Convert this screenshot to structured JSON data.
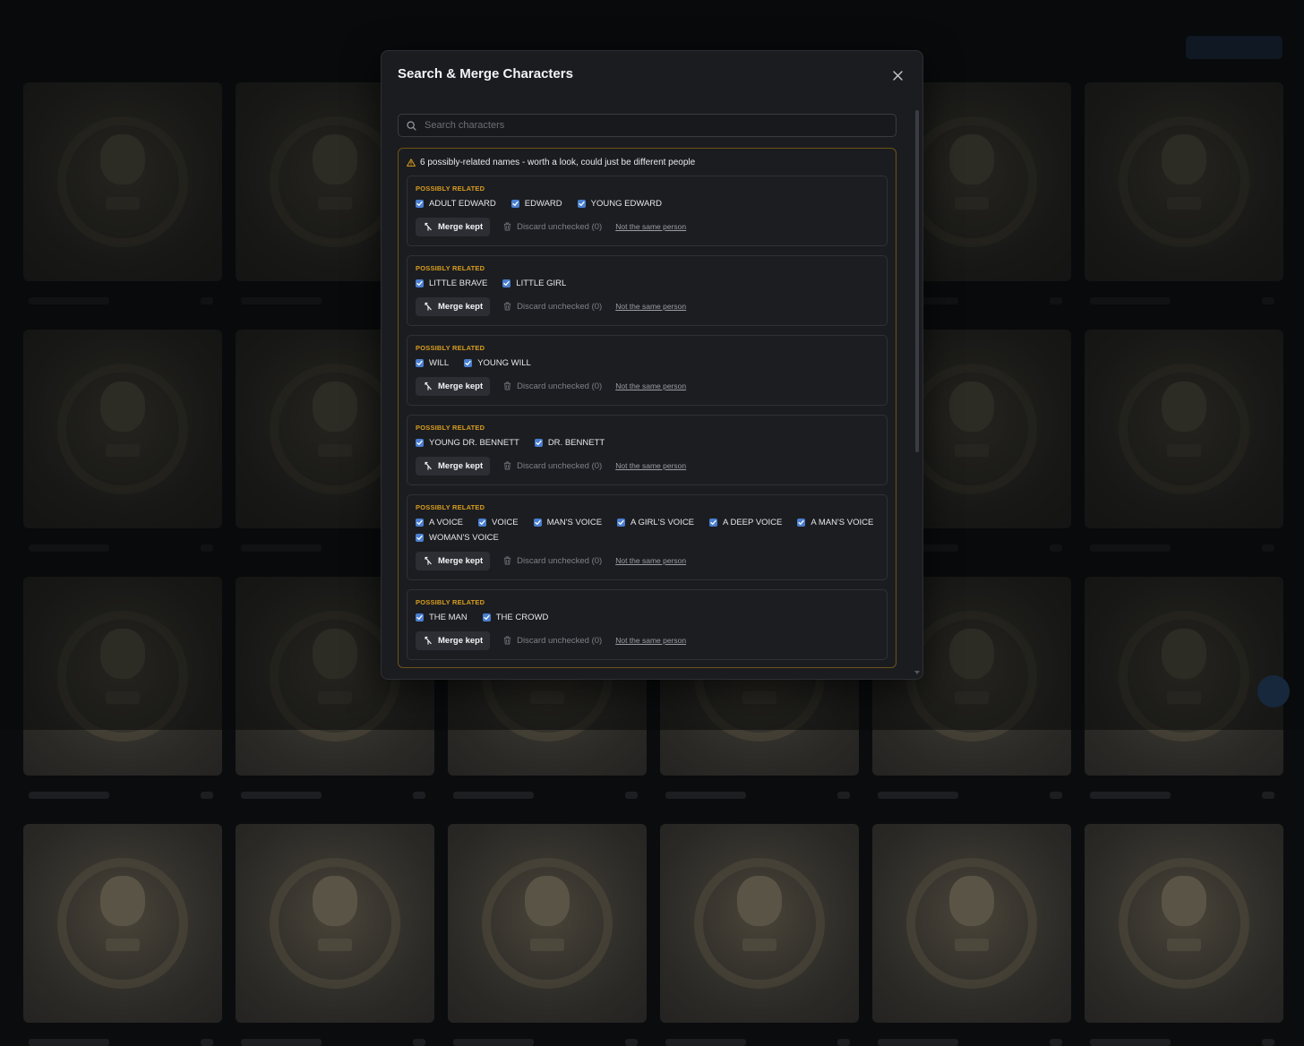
{
  "background": {
    "title": "",
    "card_count": 24
  },
  "modal": {
    "title": "Search & Merge Characters",
    "search": {
      "placeholder": "Search characters",
      "value": ""
    },
    "warning": {
      "text": "6 possibly-related names - worth a look, could just be different people",
      "accent_color": "#d89d1e"
    },
    "groups": [
      {
        "label": "POSSIBLY RELATED",
        "names": [
          "ADULT EDWARD",
          "EDWARD",
          "YOUNG EDWARD"
        ],
        "merge_label": "Merge kept",
        "discard_label": "Discard unchecked (0)",
        "not_same_label": "Not the same person"
      },
      {
        "label": "POSSIBLY RELATED",
        "names": [
          "LITTLE BRAVE",
          "LITTLE GIRL"
        ],
        "merge_label": "Merge kept",
        "discard_label": "Discard unchecked (0)",
        "not_same_label": "Not the same person"
      },
      {
        "label": "POSSIBLY RELATED",
        "names": [
          "WILL",
          "YOUNG WILL"
        ],
        "merge_label": "Merge kept",
        "discard_label": "Discard unchecked (0)",
        "not_same_label": "Not the same person"
      },
      {
        "label": "POSSIBLY RELATED",
        "names": [
          "YOUNG DR. BENNETT",
          "DR. BENNETT"
        ],
        "merge_label": "Merge kept",
        "discard_label": "Discard unchecked (0)",
        "not_same_label": "Not the same person"
      },
      {
        "label": "POSSIBLY RELATED",
        "names": [
          "A VOICE",
          "VOICE",
          "MAN'S VOICE",
          "A GIRL'S VOICE",
          "A DEEP VOICE",
          "A MAN'S VOICE",
          "WOMAN'S VOICE"
        ],
        "merge_label": "Merge kept",
        "discard_label": "Discard unchecked (0)",
        "not_same_label": "Not the same person"
      },
      {
        "label": "POSSIBLY RELATED",
        "names": [
          "THE MAN",
          "THE CROWD"
        ],
        "merge_label": "Merge kept",
        "discard_label": "Discard unchecked (0)",
        "not_same_label": "Not the same person"
      }
    ]
  },
  "icons": {
    "close": "close-icon",
    "search": "search-icon",
    "warning": "warning-triangle-icon",
    "merge": "merge-icon",
    "trash": "trash-icon",
    "check": "check-icon"
  },
  "colors": {
    "checkbox": "#4a7fd0",
    "warning_border": "#6b5418",
    "label_accent": "#d89d1e"
  }
}
